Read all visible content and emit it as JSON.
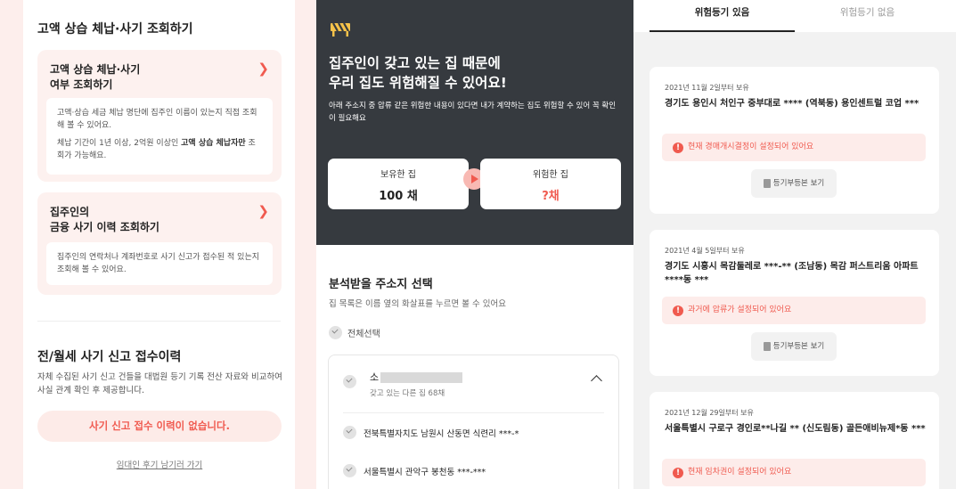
{
  "left": {
    "title": "고액 상습 체납·사기 조회하기",
    "card1": {
      "title_line1": "고액 상습 체납·사기",
      "title_line2": "여부 조회하기",
      "desc1": "고액·상습 세금 체납 명단에 집주인 이름이 있는지 직접 조회해 볼 수 있어요.",
      "desc2_prefix": "체납 기간이 1년 이상, 2억원 이상인 ",
      "desc2_bold": "고액 상습 체납자만",
      "desc2_suffix": " 조회가 가능해요."
    },
    "card2": {
      "title_line1": "집주인의",
      "title_line2": "금융 사기 이력 조회하기",
      "desc": "집주인의 연락처나 계좌번호로 사기 신고가 접수된 적 있는지 조회해 볼 수 있어요."
    },
    "title2": "전/월세 사기 신고 접수이력",
    "desc": "자체 수집된 사기 신고 건들을 대법원 등기 기록 전산 자료와 비교하여 사실 관계 확인 후 제공합니다.",
    "no_report": "사기 신고 접수 이력이 없습니다.",
    "review_link": "임대인 후기 남기러 가기"
  },
  "middle": {
    "hero_title_line1": "집주인이 갖고 있는 집 때문에",
    "hero_title_line2": "우리 집도 위험해질 수 있어요!",
    "hero_desc": "아래 주소지 중 압류 같은 위험한 내용이 있다면 내가 계약하는 집도 위험할 수 있어 꼭 확인이 필요해요",
    "owned_label": "보유한 집",
    "owned_value": "100 채",
    "risky_label": "위험한 집",
    "risky_value": "?채",
    "select_title": "분석받을 주소지 선택",
    "select_desc": "집 목록은 이름 옆의 화살표를 누르면 볼 수 있어요",
    "select_all": "전체선택",
    "owner_name": "소",
    "owner_sub": "갖고 있는 다른 집 68채",
    "addresses": [
      "전북특별자치도 남원시 산동면 식련리 ***-*",
      "서울특별시 관악구 봉천동 ***-***"
    ]
  },
  "right": {
    "tab_active": "위험등기 있음",
    "tab_inactive": "위험등기 없음",
    "cards": [
      {
        "date": "2021년 11월 2일부터 보유",
        "address": "경기도 용인시 처인구 중부대로 **** (역북동) 용인센트럴 코업 ***",
        "warning": "현재 경매개시결정이 설정되어 있어요",
        "button": "등기부등본 보기"
      },
      {
        "date": "2021년 4월 5일부터 보유",
        "address": "경기도 시흥시 목감둘레로 ***-** (조남동) 목감 퍼스트리움 아파트 ****동 ***",
        "warning": "과거에 압류가 설정되어 있어요",
        "button": "등기부등본 보기"
      },
      {
        "date": "2021년 12월 29일부터 보유",
        "address": "서울특별시 구로구 경인로**나길 ** (신도림동) 골든애비뉴제*동 ***",
        "warning": "현재 임차권이 설정되어 있어요",
        "button": "등기부등본 보기"
      }
    ]
  },
  "colors": {
    "accent": "#f05a4f",
    "dark": "#363a3f",
    "bg_pink": "#fdeeec"
  },
  "icons": {
    "chevron": "chevron-right-icon",
    "barrier": "barrier-icon",
    "warning": "warning-icon",
    "document": "document-icon",
    "check": "check-icon",
    "play": "play-icon",
    "caret": "chevron-up-icon"
  }
}
